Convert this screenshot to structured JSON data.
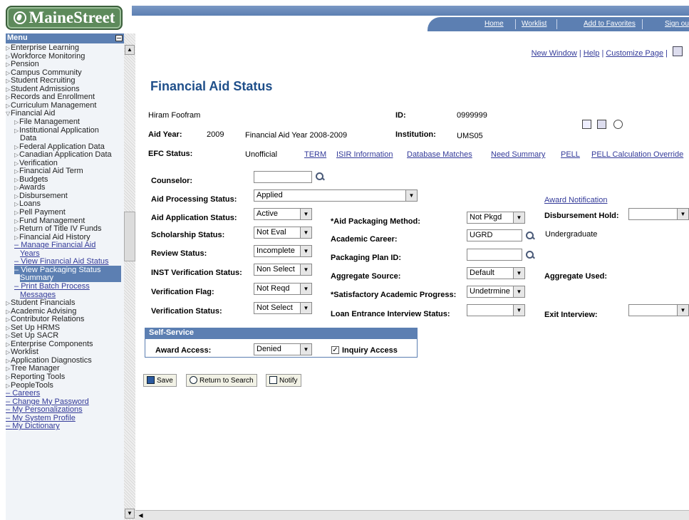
{
  "brand": {
    "logo_text": "MaineStreet"
  },
  "topnav": {
    "home": "Home",
    "worklist": "Worklist",
    "favorites": "Add to Favorites",
    "signout": "Sign ou"
  },
  "sidebar": {
    "title": "Menu",
    "items": [
      {
        "label": "Enterprise Learning",
        "type": "folder",
        "indent": 0
      },
      {
        "label": "Workforce Monitoring",
        "type": "folder",
        "indent": 0
      },
      {
        "label": "Pension",
        "type": "folder",
        "indent": 0
      },
      {
        "label": "Campus Community",
        "type": "folder",
        "indent": 0
      },
      {
        "label": "Student Recruiting",
        "type": "folder",
        "indent": 0
      },
      {
        "label": "Student Admissions",
        "type": "folder",
        "indent": 0
      },
      {
        "label": "Records and Enrollment",
        "type": "folder",
        "indent": 0
      },
      {
        "label": "Curriculum Management",
        "type": "folder",
        "indent": 0
      },
      {
        "label": "Financial Aid",
        "type": "open",
        "indent": 0
      },
      {
        "label": "File Management",
        "type": "folder",
        "indent": 1
      },
      {
        "label": "Institutional Application",
        "type": "folder",
        "indent": 1
      },
      {
        "label": "Data",
        "type": "cont",
        "indent": 1
      },
      {
        "label": "Federal Application Data",
        "type": "folder",
        "indent": 1
      },
      {
        "label": "Canadian Application Data",
        "type": "folder",
        "indent": 1
      },
      {
        "label": "Verification",
        "type": "folder",
        "indent": 1
      },
      {
        "label": "Financial Aid Term",
        "type": "folder",
        "indent": 1
      },
      {
        "label": "Budgets",
        "type": "folder",
        "indent": 1
      },
      {
        "label": "Awards",
        "type": "folder",
        "indent": 1
      },
      {
        "label": "Disbursement",
        "type": "folder",
        "indent": 1
      },
      {
        "label": "Loans",
        "type": "folder",
        "indent": 1
      },
      {
        "label": "Pell Payment",
        "type": "folder",
        "indent": 1
      },
      {
        "label": "Fund Management",
        "type": "folder",
        "indent": 1
      },
      {
        "label": "Return of Title IV Funds",
        "type": "folder",
        "indent": 1
      },
      {
        "label": "Financial Aid History",
        "type": "folder",
        "indent": 1
      },
      {
        "label": "Manage Financial Aid",
        "type": "link",
        "indent": 1
      },
      {
        "label": "Years",
        "type": "linkcont",
        "indent": 1
      },
      {
        "label": "View Financial Aid Status",
        "type": "link",
        "indent": 1
      },
      {
        "label": "View Packaging Status",
        "type": "selected",
        "indent": 1
      },
      {
        "label": "Summary",
        "type": "selcont",
        "indent": 1
      },
      {
        "label": "Print Batch Process",
        "type": "link",
        "indent": 1
      },
      {
        "label": "Messages",
        "type": "linkcont",
        "indent": 1
      },
      {
        "label": "Student Financials",
        "type": "folder",
        "indent": 0
      },
      {
        "label": "Academic Advising",
        "type": "folder",
        "indent": 0
      },
      {
        "label": "Contributor Relations",
        "type": "folder",
        "indent": 0
      },
      {
        "label": "Set Up HRMS",
        "type": "folder",
        "indent": 0
      },
      {
        "label": "Set Up SACR",
        "type": "folder",
        "indent": 0
      },
      {
        "label": "Enterprise Components",
        "type": "folder",
        "indent": 0
      },
      {
        "label": "Worklist",
        "type": "folder",
        "indent": 0
      },
      {
        "label": "Application Diagnostics",
        "type": "folder",
        "indent": 0
      },
      {
        "label": "Tree Manager",
        "type": "folder",
        "indent": 0
      },
      {
        "label": "Reporting Tools",
        "type": "folder",
        "indent": 0
      },
      {
        "label": "PeopleTools",
        "type": "folder",
        "indent": 0
      },
      {
        "label": "Careers",
        "type": "toplink",
        "indent": 0
      },
      {
        "label": "Change My Password",
        "type": "toplink",
        "indent": 0
      },
      {
        "label": "My Personalizations",
        "type": "toplink",
        "indent": 0
      },
      {
        "label": "My System Profile",
        "type": "toplink",
        "indent": 0
      },
      {
        "label": "My Dictionary",
        "type": "toplink",
        "indent": 0
      }
    ]
  },
  "toplinks": {
    "new_window": "New Window",
    "help": "Help",
    "customize": "Customize Page",
    "sep": "|"
  },
  "page": {
    "title": "Financial Aid Status",
    "student_name": "Hiram Foofram",
    "id_label": "ID:",
    "id_value": "0999999",
    "aid_year_label": "Aid Year:",
    "aid_year_value": "2009",
    "aid_year_desc": "Financial Aid Year 2008-2009",
    "institution_label": "Institution:",
    "institution_value": "UMS05",
    "efc_label": "EFC Status:",
    "efc_value": "Unofficial",
    "links": {
      "term": "TERM",
      "isir": "ISIR Information",
      "db_matches": "Database Matches",
      "need_summary": "Need Summary",
      "pell": "PELL",
      "pell_calc": "PELL Calculation Override"
    },
    "counselor_label": "Counselor:",
    "counselor_value": "",
    "aid_processing_label": "Aid Processing Status:",
    "aid_processing_value": "Applied",
    "award_notification": "Award Notification",
    "aid_application_label": "Aid Application Status:",
    "aid_application_value": "Active",
    "aid_packaging_label": "*Aid Packaging Method:",
    "aid_packaging_value": "Not Pkgd",
    "disbursement_hold_label": "Disbursement Hold:",
    "disbursement_hold_value": "",
    "scholarship_label": "Scholarship Status:",
    "scholarship_value": "Not Eval",
    "academic_career_label": "Academic Career:",
    "academic_career_value": "UGRD",
    "academic_career_desc": "Undergraduate",
    "review_label": "Review Status:",
    "review_value": "Incomplete",
    "packaging_plan_label": "Packaging Plan ID:",
    "packaging_plan_value": "",
    "inst_verif_label": "INST Verification Status:",
    "inst_verif_value": "Non Select",
    "aggregate_source_label": "Aggregate Source:",
    "aggregate_source_value": "Default",
    "aggregate_used_label": "Aggregate Used:",
    "verif_flag_label": "Verification Flag:",
    "verif_flag_value": "Not Reqd",
    "sap_label": "*Satisfactory Academic Progress:",
    "sap_value": "Undetrmine",
    "verif_status_label": "Verification Status:",
    "verif_status_value": "Not Select",
    "loan_entrance_label": "Loan Entrance Interview Status:",
    "loan_entrance_value": "",
    "exit_interview_label": "Exit Interview:",
    "exit_interview_value": ""
  },
  "self_service": {
    "title": "Self-Service",
    "award_access_label": "Award Access:",
    "award_access_value": "Denied",
    "inquiry_label": "Inquiry Access",
    "inquiry_checked": true
  },
  "buttons": {
    "save": "Save",
    "return": "Return to Search",
    "notify": "Notify"
  }
}
